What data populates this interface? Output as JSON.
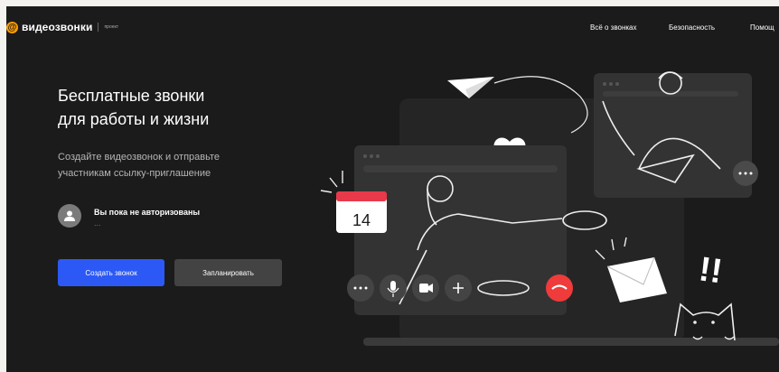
{
  "header": {
    "logo_symbol": "@",
    "logo_text": "видеозвонки",
    "logo_sub": "проект",
    "nav": [
      "Всё о звонках",
      "Безопасность",
      "Помощ"
    ]
  },
  "hero": {
    "title_line1": "Бесплатные звонки",
    "title_line2": "для работы и жизни",
    "subtitle_line1": "Создайте видеозвонок и отправьте",
    "subtitle_line2": "участникам ссылку-приглашение"
  },
  "auth": {
    "status": "Вы пока не авторизованы",
    "dots": "..."
  },
  "buttons": {
    "create": "Создать звонок",
    "schedule": "Запланировать"
  },
  "illustration": {
    "calendar_day": "14",
    "exclaim": "!!",
    "icons": [
      "more-icon",
      "mic-icon",
      "camera-icon",
      "plus-icon",
      "hangup-icon",
      "heart-icon",
      "paper-plane-icon",
      "envelope-icon",
      "cat-icon"
    ]
  },
  "colors": {
    "background": "#1b1b1b",
    "accent": "#2c59f5",
    "logo": "#ff9e00",
    "hangup": "#ef3b3b",
    "calendar": "#e8394a"
  }
}
